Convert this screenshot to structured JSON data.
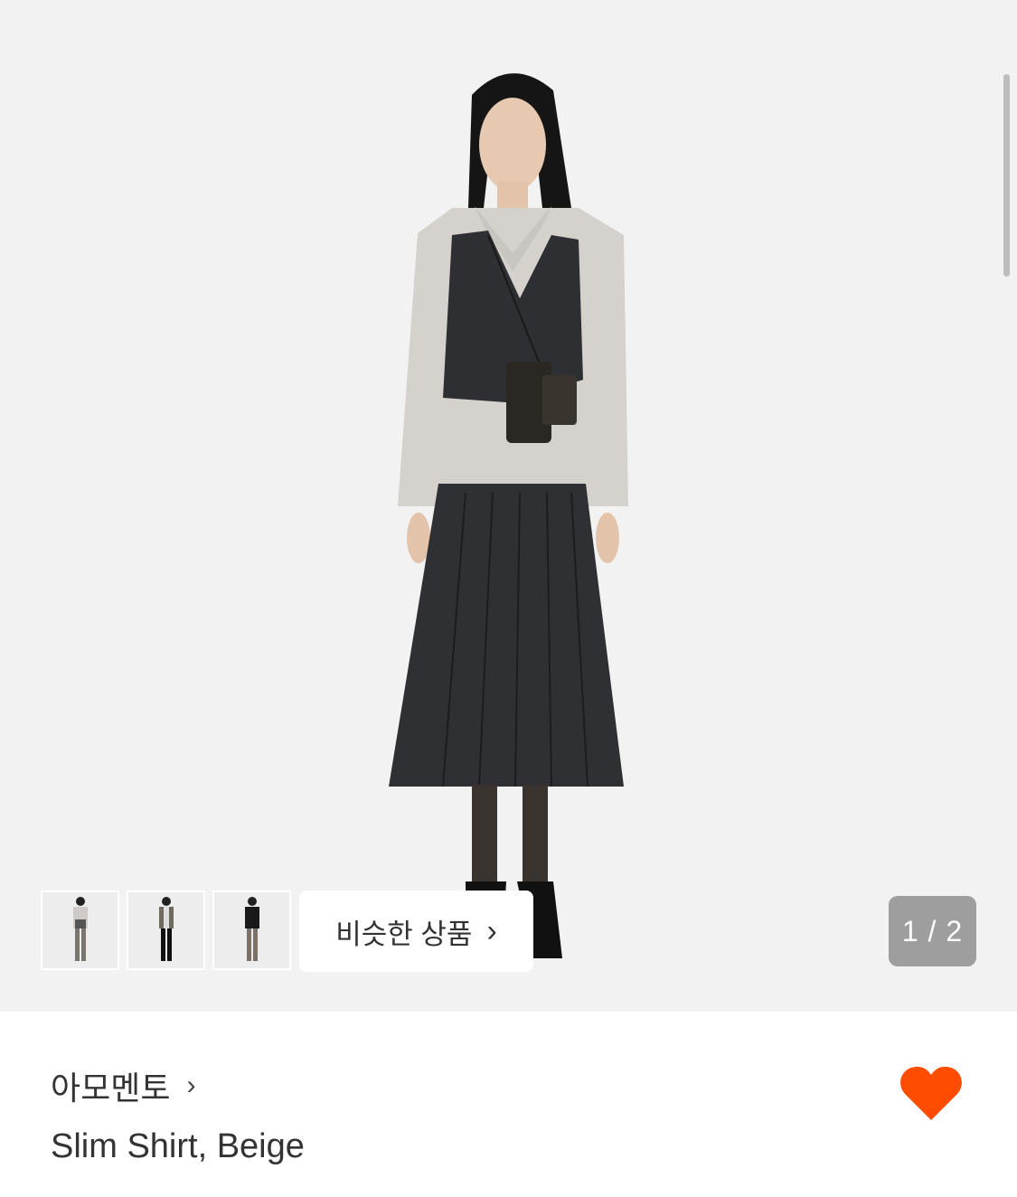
{
  "gallery": {
    "similar_button_label": "비슷한 상품",
    "similar_button_chevron": "›",
    "counter": "1 / 2",
    "thumbnails": [
      {
        "icon": "model-thumbnail-1"
      },
      {
        "icon": "model-thumbnail-2"
      },
      {
        "icon": "model-thumbnail-3"
      }
    ]
  },
  "product": {
    "brand": "아모멘토",
    "brand_chevron": "›",
    "name": "Slim Shirt, Beige",
    "wishlisted": true
  },
  "colors": {
    "accent": "#ff4d00",
    "background": "#f2f2f2"
  }
}
